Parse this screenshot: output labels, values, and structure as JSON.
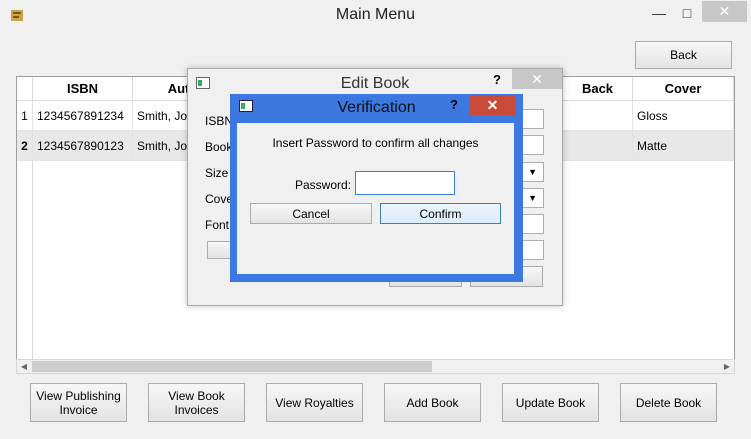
{
  "main_window": {
    "title": "Main Menu",
    "minimize_glyph": "—",
    "maximize_glyph": "□",
    "close_glyph": "✕",
    "back_button": "Back"
  },
  "books_table": {
    "columns": [
      "ISBN",
      "Auth",
      "Back",
      "Cover"
    ],
    "rows": [
      {
        "num": "1",
        "isbn": "1234567891234",
        "author": "Smith, Joh",
        "back": "",
        "cover": "Gloss"
      },
      {
        "num": "2",
        "isbn": "1234567890123",
        "author": "Smith, Joh",
        "back": "",
        "cover": "Matte"
      }
    ]
  },
  "bottom_buttons": [
    "View Publishing Invoice",
    "View Book Invoices",
    "View Royalties",
    "Add Book",
    "Update Book",
    "Delete Book"
  ],
  "edit_dialog": {
    "title": "Edit Book",
    "help_glyph": "?",
    "close_glyph": "✕",
    "labels": [
      "ISBN",
      "Book",
      "Size",
      "Cove",
      "Font"
    ],
    "partial_button_text": "n"
  },
  "verification_dialog": {
    "title": "Verification",
    "help_glyph": "?",
    "close_glyph": "✕",
    "message": "Insert Password to confirm all changes",
    "password_label": "Password:",
    "password_value": "",
    "cancel_label": "Cancel",
    "confirm_label": "Confirm"
  },
  "colors": {
    "active_frame": "#3c78e0",
    "close_active": "#c74a3a",
    "close_inactive": "#c7c7c7"
  }
}
